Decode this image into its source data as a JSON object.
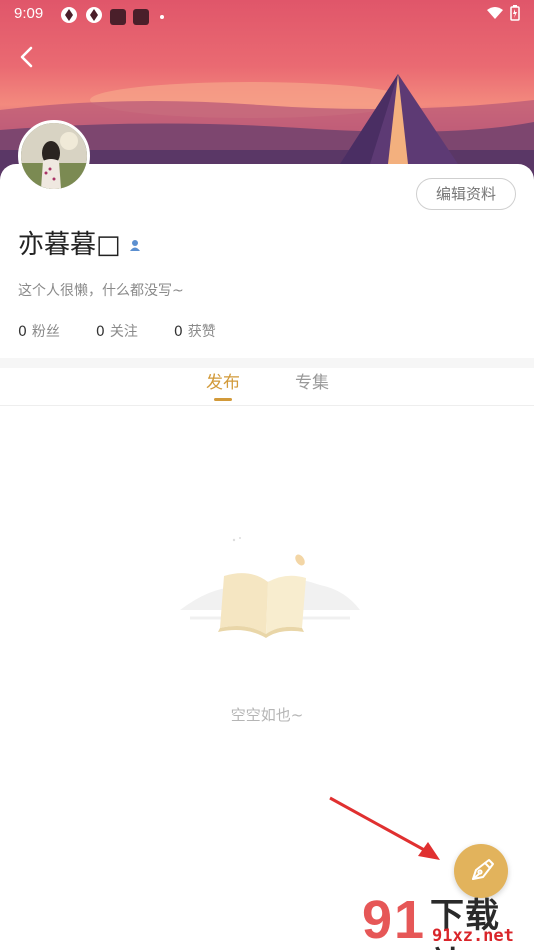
{
  "status_bar": {
    "time": "9:09"
  },
  "header": {
    "back_icon": "chevron-left-icon"
  },
  "profile": {
    "edit_label": "编辑资料",
    "username": "亦暮暮□",
    "bio": "这个人很懒，什么都没写~",
    "stats": [
      {
        "value": "0",
        "label": "粉丝"
      },
      {
        "value": "0",
        "label": "关注"
      },
      {
        "value": "0",
        "label": "获赞"
      }
    ]
  },
  "tabs": [
    {
      "label": "发布",
      "active": true
    },
    {
      "label": "专集",
      "active": false
    }
  ],
  "empty_state": {
    "text": "空空如也~",
    "icon": "open-book-icon"
  },
  "fab": {
    "icon": "pen-icon"
  },
  "watermark": {
    "main": "下载站",
    "sub": "91xz.net"
  },
  "colors": {
    "accent": "#d29a3a",
    "fab": "#e2b35c",
    "annotation_arrow": "#e03030"
  }
}
